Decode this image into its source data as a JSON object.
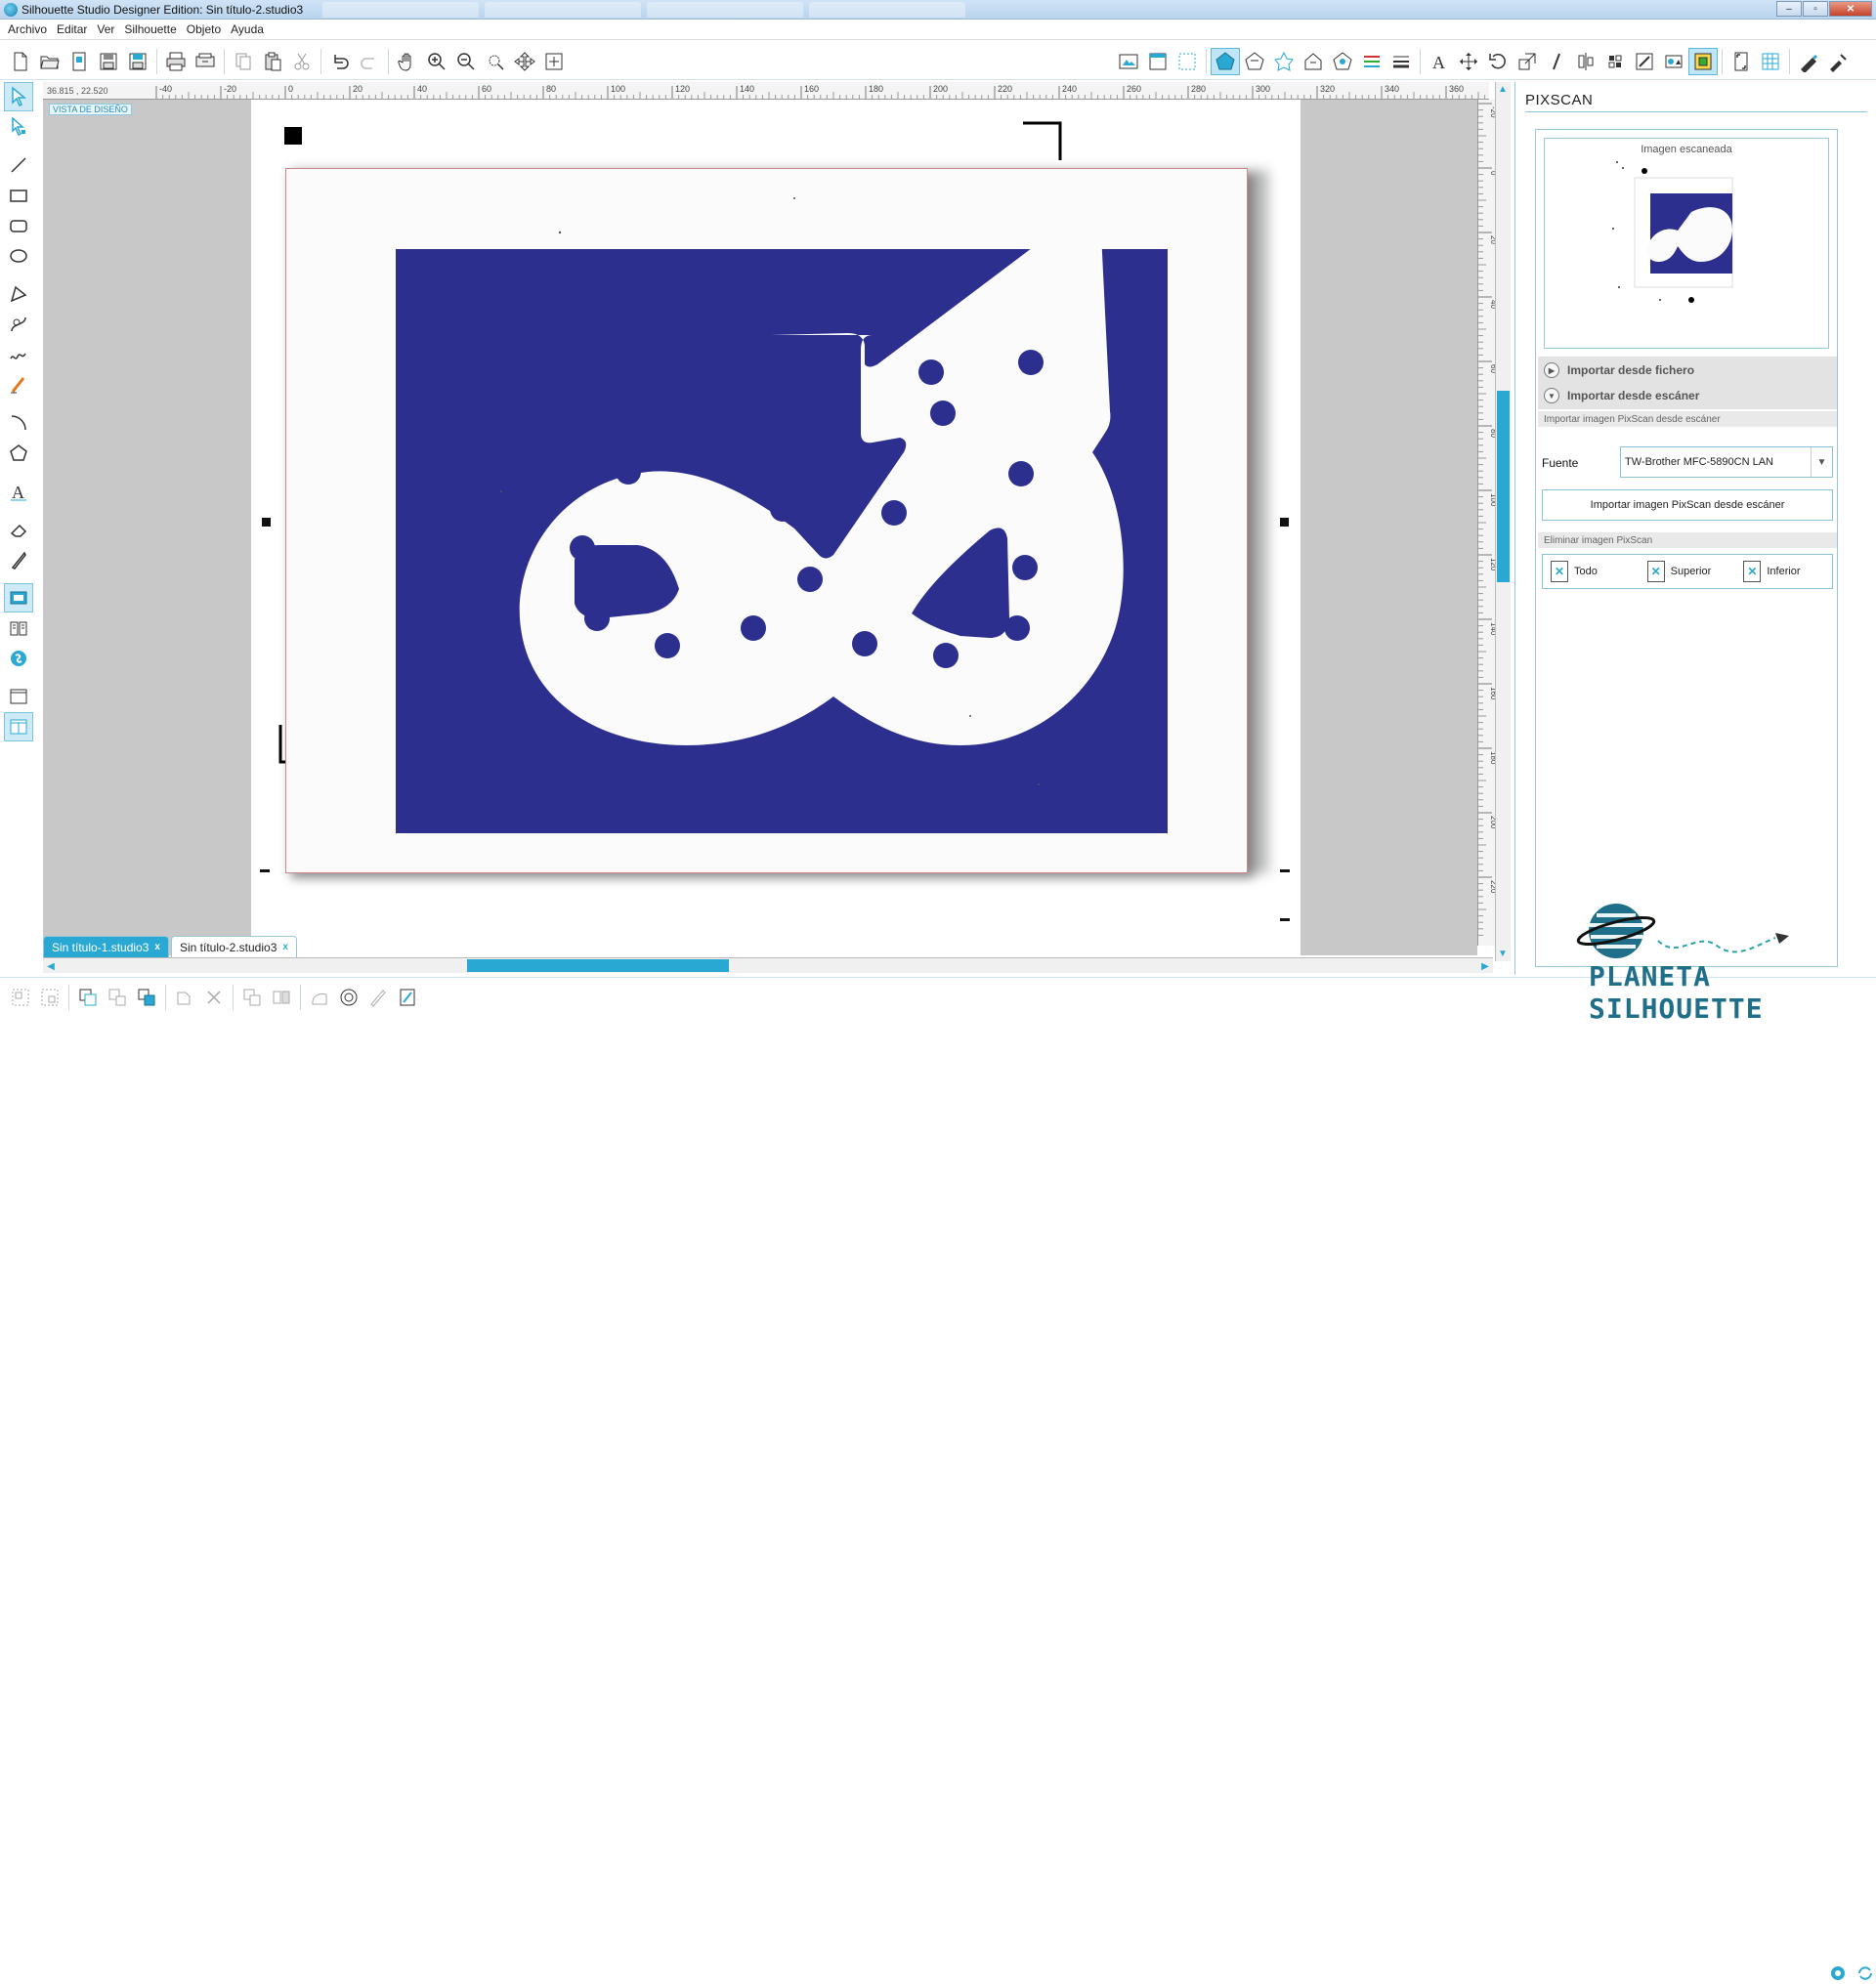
{
  "window": {
    "title": "Silhouette Studio Designer Edition: Sin título-2.studio3"
  },
  "menu": {
    "items": [
      "Archivo",
      "Editar",
      "Ver",
      "Silhouette",
      "Objeto",
      "Ayuda"
    ]
  },
  "workspace": {
    "coords": "36.815 , 22.520",
    "design_view_label": "VISTA DE DISEÑO",
    "ruler_top_ticks": [
      "-40",
      "-20",
      "0",
      "20",
      "40",
      "60",
      "80",
      "100",
      "120",
      "140",
      "160",
      "180",
      "200",
      "220",
      "240",
      "260",
      "280",
      "300",
      "320",
      "340",
      "360"
    ],
    "ruler_left_ticks": [
      "-20",
      "0",
      "20",
      "40",
      "60",
      "80",
      "100",
      "120",
      "140",
      "160",
      "180",
      "200",
      "220"
    ]
  },
  "documents": {
    "tabs": [
      {
        "label": "Sin título-1.studio3",
        "close": "x",
        "active": true
      },
      {
        "label": "Sin título-2.studio3",
        "close": "x",
        "active": false
      }
    ]
  },
  "panel": {
    "title": "PIXSCAN",
    "scanned_image_caption": "Imagen escaneada",
    "import_file": "Importar desde fichero",
    "import_scanner": "Importar desde escáner",
    "scanner_subhead": "Importar imagen PixScan desde escáner",
    "source_label": "Fuente",
    "source_value": "TW-Brother MFC-5890CN LAN",
    "import_scanner_button": "Importar imagen PixScan desde escáner",
    "delete_subhead": "Eliminar imagen PixScan",
    "delete_all": "Todo",
    "delete_top": "Superior",
    "delete_bottom": "Inferior"
  },
  "logo": {
    "text": "PLANETA SILHOUETTE"
  },
  "colors": {
    "accent": "#29a8d4",
    "scan_blue": "#2d2f8f",
    "workspace_gray": "#c8c8c8"
  }
}
